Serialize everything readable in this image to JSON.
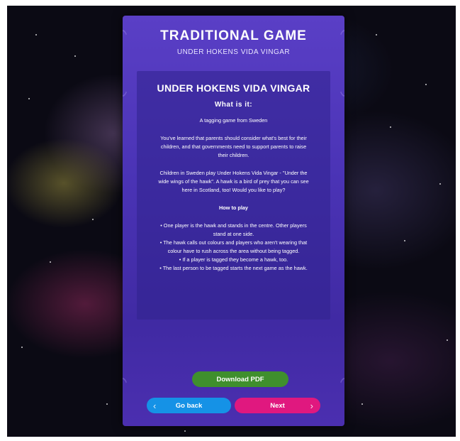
{
  "header": {
    "title": "TRADITIONAL GAME",
    "subtitle": "UNDER HOKENS VIDA VINGAR"
  },
  "card": {
    "title": "UNDER HOKENS VIDA VINGAR",
    "what_is_it": "What is it:",
    "intro": "A tagging game from Sweden",
    "para1_l1": "You've learned that parents should consider what's best for their",
    "para1_l2": "children, and that governments need to support parents to raise",
    "para1_l3": "their children.",
    "para2_l1": "Children in Sweden play Under Hokens Vida Vingar - \"Under the",
    "para2_l2": "wide wings of the hawk\". A hawk is a bird of prey that you can see",
    "para2_l3": "here in Scotland, too! Would you like to play?",
    "how_to_play": "How to play",
    "rule1_l1": "• One player is the hawk and stands in the centre. Other players",
    "rule1_l2": "stand at one side.",
    "rule2_l1": "• The hawk calls out colours and players who aren't wearing that",
    "rule2_l2": "colour have to rush across the area without being tagged.",
    "rule3": "• If a player is tagged they become a hawk, too.",
    "rule4": "• The last person to be tagged starts the next game as the hawk."
  },
  "buttons": {
    "download": "Download PDF",
    "back": "Go back",
    "next": "Next"
  },
  "icons": {
    "back": "chevron-left-icon",
    "next": "chevron-right-icon"
  },
  "colors": {
    "panel": "#4a33b5",
    "download": "#3f8f2d",
    "back": "#1592e6",
    "next": "#e0187f"
  }
}
